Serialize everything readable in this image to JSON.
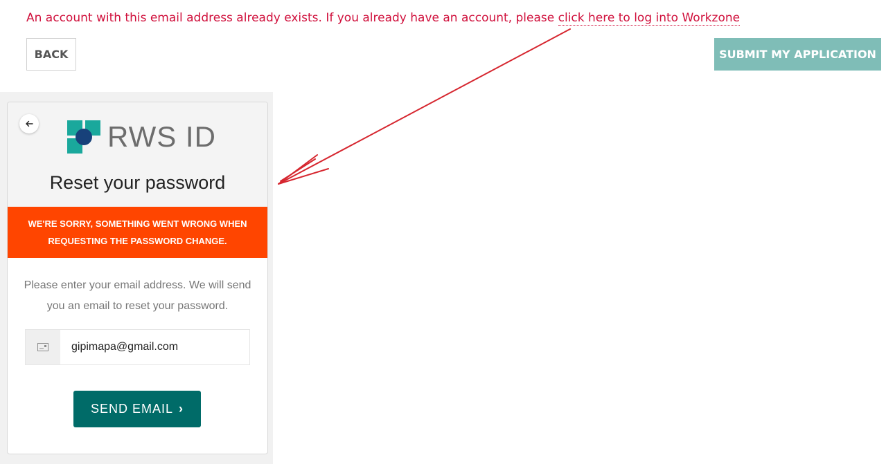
{
  "top": {
    "error_prefix": "An account with this email address already exists. If you already have an account, please ",
    "error_link": "click here to log into Workzone",
    "back_label": "BACK",
    "submit_label": "SUBMIT MY APPLICATION"
  },
  "card": {
    "logo_text": "RWS ID",
    "title": "Reset your password",
    "alert": "WE'RE SORRY, SOMETHING WENT WRONG WHEN REQUESTING THE PASSWORD CHANGE.",
    "instructions": "Please enter your email address. We will send you an email to reset your password.",
    "email_value": "gipimapa@gmail.com",
    "send_label": "SEND EMAIL",
    "send_chevron": "›"
  },
  "icons": {
    "back": "arrow-left-icon",
    "email": "envelope-icon",
    "logo": "rws-logo-icon"
  },
  "colors": {
    "error_text": "#d0103c",
    "submit_bg": "#7fbdb7",
    "alert_bg": "#ff4500",
    "send_bg": "#006b68",
    "logo_teal": "#1aa89c",
    "logo_navy": "#17417a",
    "annotation_arrow": "#d6262f"
  }
}
